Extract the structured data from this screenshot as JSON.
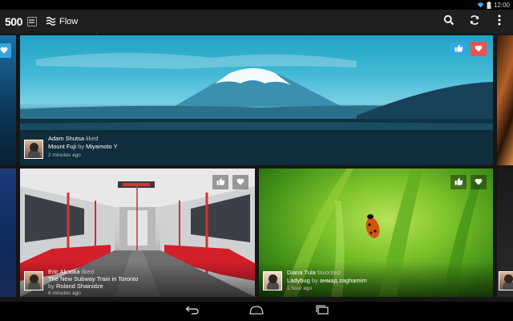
{
  "status_bar": {
    "time": "12:00"
  },
  "action_bar": {
    "logo": "500",
    "flow_label": "Flow",
    "icons": [
      "menu-tiles-icon",
      "flow-icon",
      "search-icon",
      "refresh-icon",
      "overflow-menu-icon"
    ]
  },
  "feed": {
    "cards": [
      {
        "id": "fuji",
        "user": "Adam Shutsa",
        "action": "liked",
        "photo_title": "Mount Fuji",
        "by_word": "by",
        "photographer": "Miyamoto Y",
        "time": "2 minutes ago"
      },
      {
        "id": "subway",
        "user": "Eric Akaoka",
        "action": "liked",
        "photo_title": "The New Subway Train in Toronto",
        "by_word": "by",
        "photographer": "Roland Shainidze",
        "time": "6 minutes ago"
      },
      {
        "id": "ladybug",
        "user": "Diana Tula",
        "action": "favorited",
        "photo_title": "Ladybug",
        "by_word": "by",
        "photographer": "анмад zaghamim",
        "time": "1 hour ago"
      }
    ]
  },
  "colors": {
    "like_button": "#35a7e0",
    "favorite_button": "#e85350",
    "action_bar": "#1f1f1f"
  },
  "nav_bar": {
    "icons": [
      "back-icon",
      "home-icon",
      "recents-icon"
    ]
  }
}
